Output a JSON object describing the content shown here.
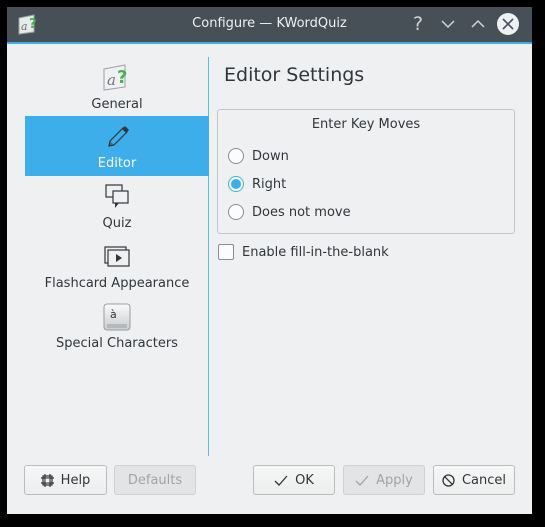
{
  "window": {
    "title": "Configure — KWordQuiz",
    "app_icon": "kwordquiz-app-icon",
    "controls": [
      {
        "name": "help",
        "glyph": "?"
      },
      {
        "name": "minimize",
        "icon": "chevron-down-icon"
      },
      {
        "name": "maximize",
        "icon": "chevron-up-icon"
      },
      {
        "name": "close",
        "icon": "close-icon"
      }
    ]
  },
  "sidebar": {
    "selected": "Editor",
    "items": [
      {
        "label": "General",
        "icon": "kwordquiz-general-icon"
      },
      {
        "label": "Editor",
        "icon": "pencil-icon"
      },
      {
        "label": "Quiz",
        "icon": "speech-bubbles-icon"
      },
      {
        "label": "Flashcard Appearance",
        "icon": "slides-play-icon"
      },
      {
        "label": "Special Characters",
        "icon": "keyboard-key-icon",
        "key_char": "à"
      }
    ]
  },
  "page": {
    "title": "Editor Settings",
    "group": {
      "title": "Enter Key Moves",
      "options": [
        {
          "label": "Down",
          "checked": false
        },
        {
          "label": "Right",
          "checked": true
        },
        {
          "label": "Does not move",
          "checked": false
        }
      ]
    },
    "checkbox": {
      "label": "Enable fill-in-the-blank",
      "checked": false
    }
  },
  "buttons": {
    "help": "Help",
    "defaults": "Defaults",
    "ok": "OK",
    "apply": "Apply",
    "cancel": "Cancel"
  },
  "colors": {
    "accent": "#3daee9",
    "titlebar": "#475057",
    "window_bg": "#eff0f1"
  }
}
